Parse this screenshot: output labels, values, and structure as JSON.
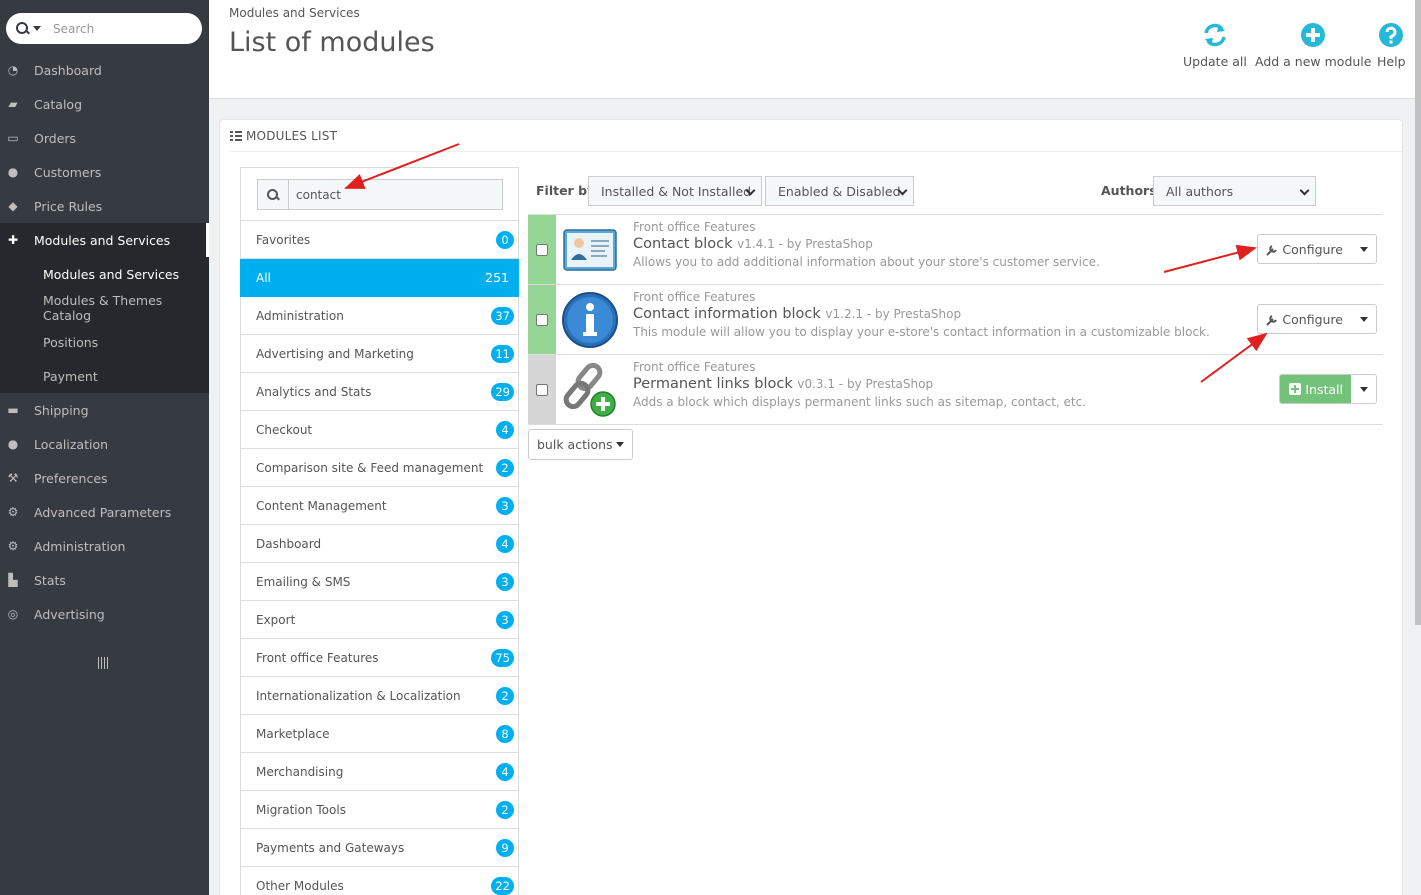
{
  "sidebar": {
    "search_placeholder": "Search",
    "items": [
      {
        "label": "Dashboard",
        "icon": "dashboard-icon"
      },
      {
        "label": "Catalog",
        "icon": "book-icon"
      },
      {
        "label": "Orders",
        "icon": "credit-card-icon"
      },
      {
        "label": "Customers",
        "icon": "users-icon"
      },
      {
        "label": "Price Rules",
        "icon": "tags-icon"
      },
      {
        "label": "Modules and Services",
        "icon": "puzzle-icon"
      },
      {
        "label": "Shipping",
        "icon": "truck-icon"
      },
      {
        "label": "Localization",
        "icon": "globe-icon"
      },
      {
        "label": "Preferences",
        "icon": "wrench-icon"
      },
      {
        "label": "Advanced Parameters",
        "icon": "cogs-icon"
      },
      {
        "label": "Administration",
        "icon": "cog-icon"
      },
      {
        "label": "Stats",
        "icon": "bar-chart-icon"
      },
      {
        "label": "Advertising",
        "icon": "bullseye-icon"
      }
    ],
    "subitems": [
      "Modules and Services",
      "Modules & Themes Catalog",
      "Positions",
      "Payment"
    ]
  },
  "header": {
    "breadcrumb": "Modules and Services",
    "title": "List of modules",
    "toolbar": {
      "update_all": "Update all",
      "add_module": "Add a new module",
      "help": "Help"
    }
  },
  "panel": {
    "heading": "MODULES LIST",
    "search_value": "contact",
    "categories": [
      {
        "label": "Favorites",
        "count": "0"
      },
      {
        "label": "All",
        "count": "251"
      },
      {
        "label": "Administration",
        "count": "37"
      },
      {
        "label": "Advertising and Marketing",
        "count": "11"
      },
      {
        "label": "Analytics and Stats",
        "count": "29"
      },
      {
        "label": "Checkout",
        "count": "4"
      },
      {
        "label": "Comparison site & Feed management",
        "count": "2"
      },
      {
        "label": "Content Management",
        "count": "3"
      },
      {
        "label": "Dashboard",
        "count": "4"
      },
      {
        "label": "Emailing & SMS",
        "count": "3"
      },
      {
        "label": "Export",
        "count": "3"
      },
      {
        "label": "Front office Features",
        "count": "75"
      },
      {
        "label": "Internationalization & Localization",
        "count": "2"
      },
      {
        "label": "Marketplace",
        "count": "8"
      },
      {
        "label": "Merchandising",
        "count": "4"
      },
      {
        "label": "Migration Tools",
        "count": "2"
      },
      {
        "label": "Payments and Gateways",
        "count": "9"
      },
      {
        "label": "Other Modules",
        "count": "22"
      }
    ],
    "filter": {
      "label": "Filter by",
      "install_state": "Installed & Not Installed",
      "enable_state": "Enabled & Disabled",
      "authors_label": "Authors",
      "authors_value": "All authors"
    },
    "modules": [
      {
        "category": "Front office Features",
        "name": "Contact block",
        "version": "v1.4.1 - by PrestaShop",
        "desc": "Allows you to add additional information about your store's customer service.",
        "action": "Configure"
      },
      {
        "category": "Front office Features",
        "name": "Contact information block",
        "version": "v1.2.1 - by PrestaShop",
        "desc": "This module will allow you to display your e-store's contact information in a customizable block.",
        "action": "Configure"
      },
      {
        "category": "Front office Features",
        "name": "Permanent links block",
        "version": "v0.3.1 - by PrestaShop",
        "desc": "Adds a block which displays permanent links such as sitemap, contact, etc.",
        "action": "Install"
      }
    ],
    "bulk_label": "bulk actions"
  },
  "colors": {
    "sidebar_bg": "#363a41",
    "accent": "#00aff0",
    "enabled_strip": "#95d596",
    "install_green": "#72c279",
    "annotation_arrow": "#e0201f"
  }
}
